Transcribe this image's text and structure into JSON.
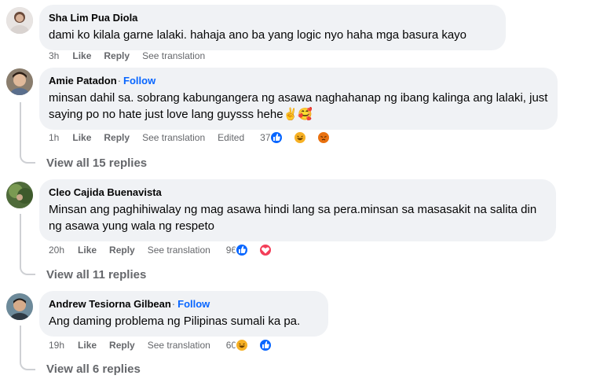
{
  "comments": [
    {
      "author": "Sha Lim Pua Diola",
      "follow": "",
      "text": "dami ko kilala garne lalaki. hahaja ano ba yang logic nyo haha mga basura kayo",
      "time": "3h",
      "like": "Like",
      "reply": "Reply",
      "translate": "See translation",
      "edited": "",
      "reaction_count": "",
      "reactions": []
    },
    {
      "author": "Amie Patadon",
      "follow": "Follow",
      "text": "minsan dahil sa. sobrang kabungangera ng asawa naghahanap ng ibang kalinga ang lalaki, just saying po no hate just love lang guysss hehe✌️🥰",
      "time": "1h",
      "like": "Like",
      "reply": "Reply",
      "translate": "See translation",
      "edited": "Edited",
      "reaction_count": "37",
      "reactions": [
        "like-reaction-icon",
        "haha-reaction-icon",
        "angry-reaction-icon"
      ],
      "view_replies": "View all 15 replies"
    },
    {
      "author": "Cleo Cajida Buenavista",
      "follow": "",
      "text": "Minsan ang paghihiwalay ng mag asawa hindi lang sa pera.minsan sa masasakit na salita din ng asawa yung wala ng respeto",
      "time": "20h",
      "like": "Like",
      "reply": "Reply",
      "translate": "See translation",
      "edited": "",
      "reaction_count": "96",
      "reactions": [
        "like-reaction-icon",
        "love-reaction-icon"
      ],
      "view_replies": "View all 11 replies"
    },
    {
      "author": "Andrew Tesiorna Gilbean",
      "follow": "Follow",
      "text": "Ang daming problema ng Pilipinas sumali ka pa.",
      "time": "19h",
      "like": "Like",
      "reply": "Reply",
      "translate": "See translation",
      "edited": "",
      "reaction_count": "60",
      "reactions": [
        "haha-reaction-icon",
        "like-reaction-icon"
      ],
      "view_replies": "View all 6 replies"
    }
  ],
  "colors": {
    "bubble": "#f0f2f5",
    "meta": "#65676b",
    "follow": "#0866ff",
    "like_reaction": "#0866ff",
    "love_reaction": "#f33e58",
    "haha_reaction": "#f7b125",
    "angry_reaction": "#e9710f"
  }
}
